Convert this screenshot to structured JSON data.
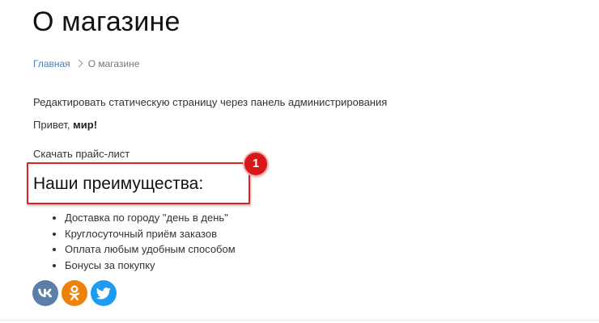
{
  "page": {
    "title": "О магазине"
  },
  "breadcrumb": {
    "home": "Главная",
    "current": "О магазине"
  },
  "content": {
    "edit_text": "Редактировать статическую страницу через панель администрирования",
    "hello_prefix": "Привет, ",
    "hello_bold": "мир!",
    "price_list_link": "Скачать прайс-лист"
  },
  "advantages": {
    "heading": "Наши преимущества:",
    "items": [
      "Доставка по городу \"день в день\"",
      "Круглосуточный приём заказов",
      "Оплата любым удобным способом",
      "Бонусы за покупку"
    ]
  },
  "annotation": {
    "badge_number": "1",
    "color": "#e02020"
  },
  "social": {
    "icons": [
      "vk-icon",
      "odnoklassniki-icon",
      "twitter-icon"
    ],
    "colors": {
      "vk": "#5b7fa6",
      "ok": "#ee8208",
      "twitter": "#1d9bf0"
    }
  }
}
